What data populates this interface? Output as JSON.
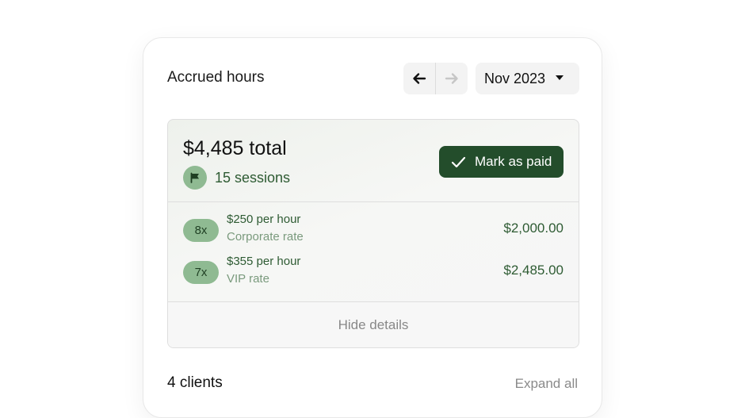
{
  "header": {
    "title": "Accrued hours",
    "month_label": "Nov 2023"
  },
  "summary": {
    "total": "$4,485 total",
    "sessions": "15 sessions",
    "mark_paid_label": "Mark as paid"
  },
  "rates": [
    {
      "qty": "8x",
      "rate": "$250 per hour",
      "kind": "Corporate rate",
      "amount": "$2,000.00"
    },
    {
      "qty": "7x",
      "rate": "$355 per hour",
      "kind": "VIP rate",
      "amount": "$2,485.00"
    }
  ],
  "details": {
    "hide_label": "Hide details"
  },
  "clients": {
    "title": "4 clients",
    "expand_label": "Expand all"
  },
  "icons": {
    "prev": "arrow-left-icon",
    "next": "arrow-right-icon",
    "dropdown": "caret-down-icon",
    "sessions": "flag-icon",
    "mark_paid": "check-icon"
  },
  "colors": {
    "brand_dark_green": "#234d2b",
    "pill_green": "#8fba92",
    "text_green": "#2e5b33",
    "muted_green": "#7a9a7d"
  }
}
